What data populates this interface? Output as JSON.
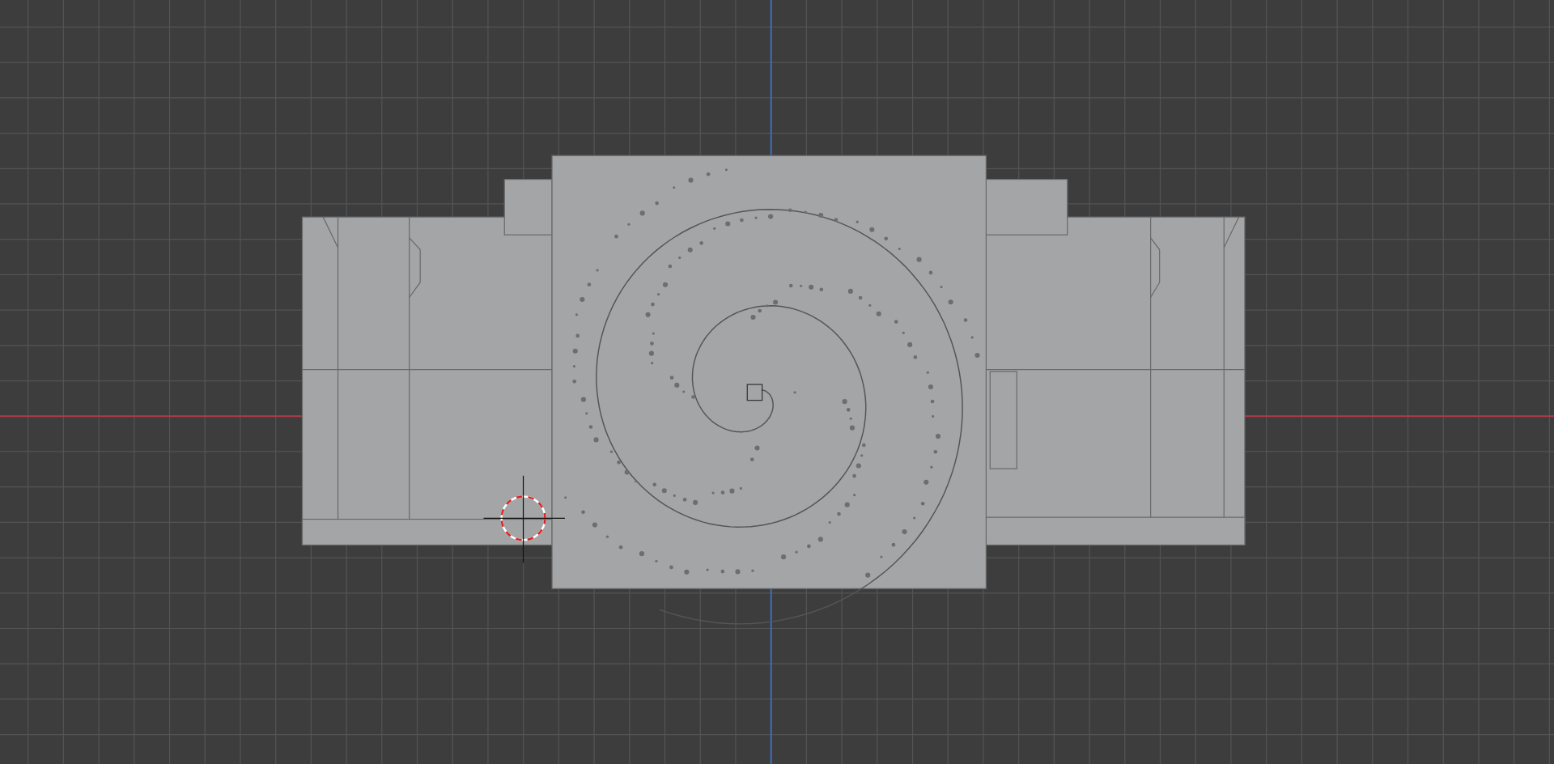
{
  "viewport": {
    "kind": "viewport"
  }
}
